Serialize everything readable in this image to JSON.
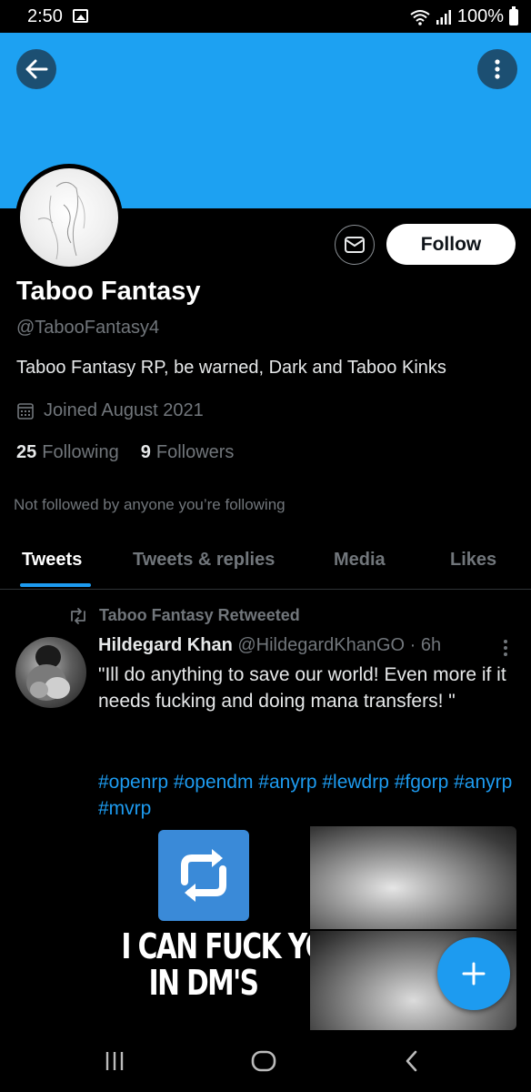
{
  "status_bar": {
    "time": "2:50",
    "battery": "100%"
  },
  "colors": {
    "banner": "#1da1f2",
    "accent": "#1d9bf0",
    "secondary_text": "#71767b"
  },
  "profile": {
    "name": "Taboo Fantasy",
    "handle": "@TabooFantasy4",
    "bio": "Taboo Fantasy RP, be warned, Dark and Taboo Kinks",
    "joined": "Joined August 2021",
    "following_count": "25",
    "following_label": "Following",
    "followers_count": "9",
    "followers_label": "Followers",
    "not_followed_text": "Not followed by anyone you’re following",
    "follow_button": "Follow"
  },
  "tabs": [
    {
      "label": "Tweets",
      "active": true
    },
    {
      "label": "Tweets & replies",
      "active": false
    },
    {
      "label": "Media",
      "active": false
    },
    {
      "label": "Likes",
      "active": false
    }
  ],
  "tweet": {
    "retweeted_by": "Taboo Fantasy Retweeted",
    "author_name": "Hildegard Khan",
    "author_handle": "@HildegardKhanGO",
    "time": "· 6h",
    "text": "\"Ill do anything to save our world! Even more if it needs fucking and doing mana transfers! \"",
    "hashtags": "#openrp #opendm #anyrp #lewdrp  #fgorp #anyrp #mvrp",
    "media_text_line1": "I CAN FUCK YO",
    "media_text_line2": "IN DM'S"
  },
  "icons": {
    "back": "arrow-left-icon",
    "more": "more-vertical-icon",
    "mail": "mail-icon",
    "calendar": "calendar-icon",
    "retweet": "retweet-icon",
    "compose": "plus-icon",
    "nav_recents": "recents-icon",
    "nav_home": "home-icon",
    "nav_back": "chevron-left-icon"
  }
}
